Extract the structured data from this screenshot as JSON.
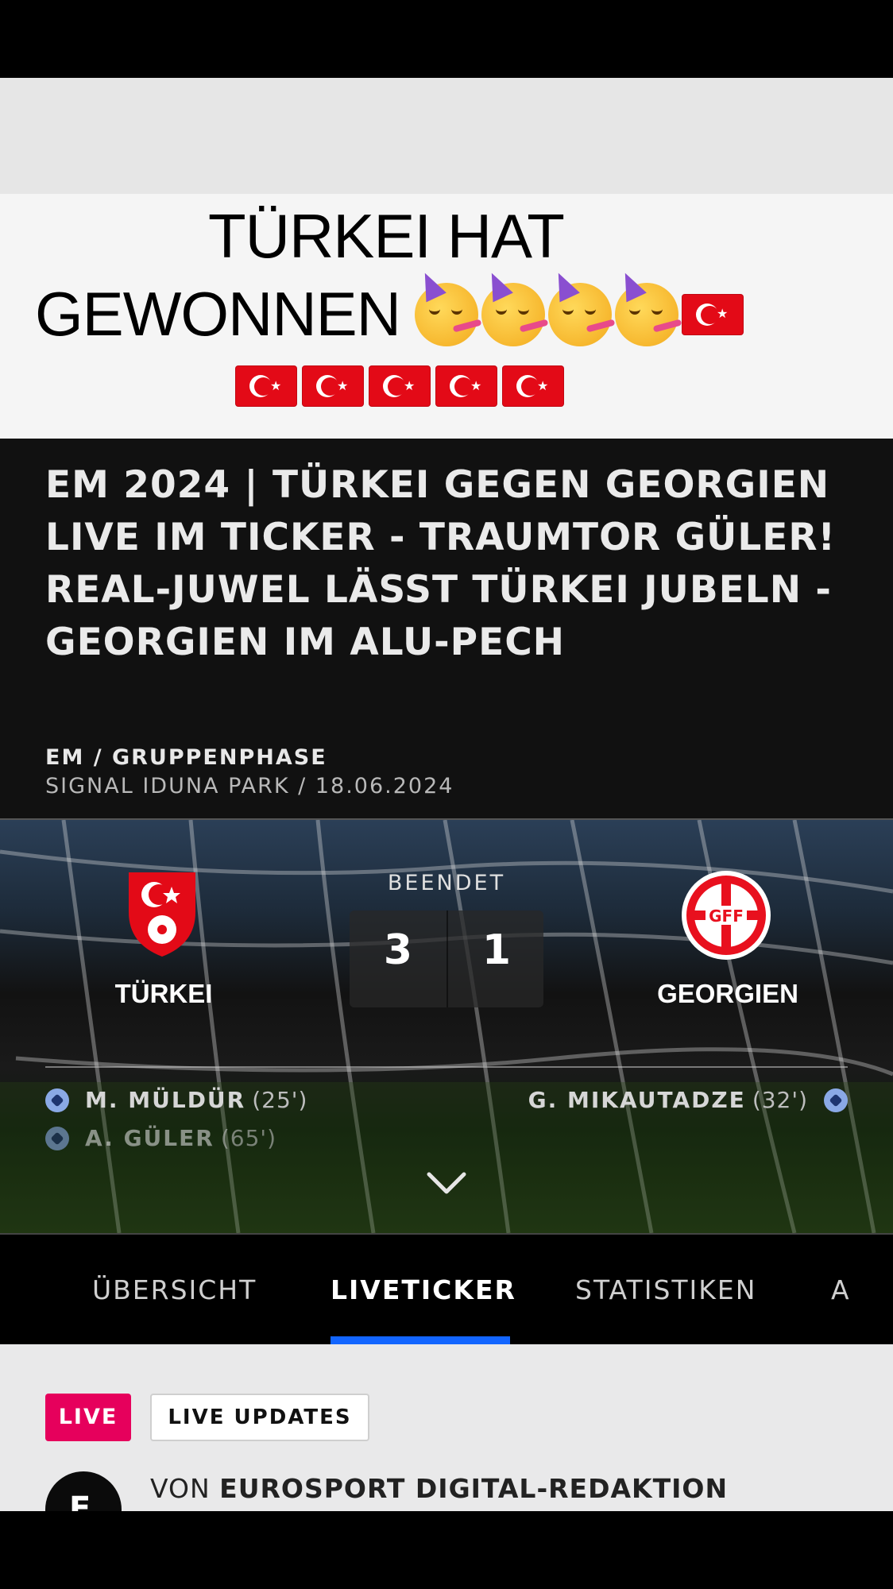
{
  "caption": {
    "line1": "TÜRKEI HAT",
    "line2": "GEWONNEN",
    "emoji_faces": [
      "partying-face-emoji",
      "partying-face-emoji",
      "partying-face-emoji",
      "partying-face-emoji"
    ],
    "flags_line2": 1,
    "flags_line3": 5
  },
  "article": {
    "title": "EM 2024 | TÜRKEI GEGEN GEORGIEN LIVE IM TICKER - TRAUMTOR GÜLER! REAL-JUWEL LÄSST TÜRKEI JUBELN - GEORGIEN IM ALU-PECH",
    "competition": "EM / GRUPPENPHASE",
    "venue_date": "SIGNAL IDUNA PARK / 18.06.2024"
  },
  "match": {
    "status": "BEENDET",
    "home": {
      "name": "TÜRKEI",
      "score": "3",
      "crest_icon": "turkey-crest-icon"
    },
    "away": {
      "name": "GEORGIEN",
      "score": "1",
      "crest_icon": "georgia-gff-crest-icon",
      "crest_text": "GFF"
    },
    "home_scorers": [
      {
        "name": "M. MÜLDÜR",
        "minute": "(25')"
      },
      {
        "name": "A. GÜLER",
        "minute": "(65')"
      }
    ],
    "away_scorers": [
      {
        "name": "G. MIKAUTADZE",
        "minute": "(32')"
      }
    ]
  },
  "tabs": [
    {
      "label": "ÜBERSICHT",
      "active": false
    },
    {
      "label": "LIVETICKER",
      "active": true
    },
    {
      "label": "STATISTIKEN",
      "active": false
    },
    {
      "label": "A",
      "active": false
    }
  ],
  "ticker": {
    "live_label": "LIVE",
    "updates_label": "LIVE UPDATES",
    "author_prefix": "VON",
    "author_name": "EUROSPORT DIGITAL-REDAKTION"
  },
  "colors": {
    "accent_blue": "#1265ff",
    "live_pink": "#e6005c",
    "turkey_red": "#e30a17"
  }
}
